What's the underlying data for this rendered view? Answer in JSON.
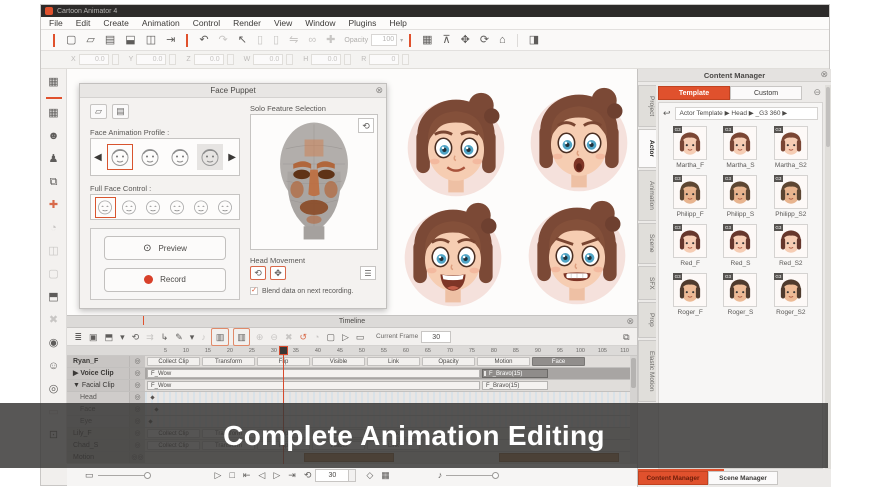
{
  "icons": {
    "close": "⊗",
    "collapse": "⊖",
    "caret": "▾",
    "left": "◀",
    "right": "▶",
    "check": "✓",
    "back": "↩",
    "refresh": "⟲",
    "list": "☰",
    "gear": "◎",
    "eye": "⊙",
    "open": "▱",
    "save": "▤",
    "rotate": "⟲",
    "move": "✥",
    "note": "♪",
    "panel": "⧉"
  },
  "window": {
    "app_title": "Cartoon Animator 4",
    "menu_items": [
      "File",
      "Edit",
      "Create",
      "Animation",
      "Control",
      "Render",
      "View",
      "Window",
      "Plugins",
      "Help"
    ]
  },
  "toolbar": {
    "group1": [
      {
        "glyph": "▢",
        "name": "new-project-icon"
      },
      {
        "glyph": "▱",
        "name": "open-project-icon"
      },
      {
        "glyph": "▤",
        "name": "save-project-icon"
      },
      {
        "glyph": "⬓",
        "name": "content-store-icon"
      },
      {
        "glyph": "◫",
        "name": "export-image-icon"
      },
      {
        "glyph": "⇥",
        "name": "export-icon"
      }
    ],
    "group2": [
      {
        "glyph": "↶",
        "name": "undo-icon"
      },
      {
        "glyph": "↷",
        "name": "redo-icon",
        "cls": "dim"
      },
      {
        "glyph": "↖",
        "name": "select-tool-icon"
      },
      {
        "glyph": "▯",
        "name": "copy-icon",
        "cls": "dim"
      },
      {
        "glyph": "▯",
        "name": "paste-icon",
        "cls": "dim"
      },
      {
        "glyph": "⇋",
        "name": "flip-icon",
        "cls": "dim"
      },
      {
        "glyph": "∞",
        "name": "link-icon",
        "cls": "dim"
      },
      {
        "glyph": "✚",
        "name": "add-icon",
        "cls": "dim"
      }
    ],
    "opacity_label": "Opacity",
    "opacity_value": "100",
    "group3": [
      {
        "glyph": "▦",
        "name": "render-style-icon"
      },
      {
        "glyph": "⊼",
        "name": "pin-icon"
      },
      {
        "glyph": "✥",
        "name": "move-tool-icon"
      },
      {
        "glyph": "⟳",
        "name": "rotate-tool-icon"
      },
      {
        "glyph": "⌂",
        "name": "home-view-icon"
      }
    ],
    "group4": [
      {
        "glyph": "◨",
        "name": "panel-toggle-icon"
      }
    ]
  },
  "transform_bar": {
    "fields": [
      {
        "label": "X",
        "value": "0.0"
      },
      {
        "label": "Y",
        "value": "0.0"
      },
      {
        "label": "Z",
        "value": "0.0"
      },
      {
        "label": "W",
        "value": "0.0"
      },
      {
        "label": "H",
        "value": "0.0"
      },
      {
        "label": "R",
        "value": "0"
      }
    ]
  },
  "sidebar": {
    "icons": [
      {
        "glyph": "▦",
        "name": "stage-media-icon"
      },
      {
        "glyph": "☻",
        "name": "actor-icon"
      },
      {
        "glyph": "♟",
        "name": "motion-icon"
      },
      {
        "glyph": "⧉",
        "name": "layer-manager-icon"
      },
      {
        "glyph": "✚",
        "name": "plugin-icon",
        "cls": "red"
      },
      {
        "glyph": "◔",
        "name": "face-key-icon",
        "cls": "dim"
      },
      {
        "glyph": "◫",
        "name": "sprite-editor-icon",
        "cls": "dim"
      },
      {
        "glyph": "▢",
        "name": "free-form-icon",
        "cls": "dim"
      },
      {
        "glyph": "⬒",
        "name": "prop-icon"
      },
      {
        "glyph": "✖",
        "name": "delete-object-icon",
        "cls": "dim"
      },
      {
        "glyph": "◉",
        "name": "camera-icon"
      },
      {
        "glyph": "☺",
        "name": "face-puppet-icon"
      },
      {
        "glyph": "◎",
        "name": "face-mocap-icon"
      },
      {
        "glyph": "▭",
        "name": "timeline-toggle-icon",
        "cls": "dim"
      },
      {
        "glyph": "⊡",
        "name": "render-icon"
      }
    ]
  },
  "viewport": {
    "faces": [
      {
        "name": "character-head-smile"
      },
      {
        "name": "character-head-surprised"
      },
      {
        "name": "character-head-laugh"
      },
      {
        "name": "character-head-grimace"
      }
    ]
  },
  "face_puppet": {
    "title": "Face Puppet",
    "solo_feature_label": "Solo Feature Selection",
    "profile_label": "Face Animation Profile :",
    "full_face_label": "Full Face Control :",
    "preview_label": "Preview",
    "record_label": "Record",
    "head_movement_label": "Head Movement",
    "blend_checkbox_label": "Blend data on next recording.",
    "profile_faces": [
      {
        "name": "profile-face-girl",
        "cls": "selected"
      },
      {
        "name": "profile-face-boy"
      },
      {
        "name": "profile-face-round"
      },
      {
        "name": "profile-face-plain",
        "cls": "shaded"
      }
    ],
    "full_face_icons": [
      {
        "name": "full-face-1",
        "cls": "selected"
      },
      {
        "name": "full-face-2"
      },
      {
        "name": "full-face-3"
      },
      {
        "name": "full-face-4"
      },
      {
        "name": "full-face-5"
      },
      {
        "name": "full-face-6"
      }
    ]
  },
  "timeline": {
    "title": "Timeline",
    "current_frame_label": "Current Frame",
    "current_frame_value": "30",
    "toolbar_icons": [
      {
        "glyph": "≣",
        "name": "track-list-icon"
      },
      {
        "glyph": "▣",
        "name": "object-track-icon"
      },
      {
        "glyph": "⬒",
        "name": "collect-clip-icon"
      },
      {
        "glyph": "▾",
        "name": "collect-clip-caret-icon"
      },
      {
        "glyph": "⟲",
        "name": "loop-clip-icon"
      },
      {
        "glyph": "⇉",
        "name": "shift-keys-icon",
        "cls": "dim"
      },
      {
        "glyph": "↳",
        "name": "break-clip-icon"
      },
      {
        "glyph": "✎",
        "name": "edit-motion-icon"
      },
      {
        "glyph": "▾",
        "name": "edit-motion-caret-icon"
      },
      {
        "glyph": "♪",
        "name": "audio-track-icon",
        "cls": "dim"
      },
      {
        "glyph": "▥",
        "name": "zoom-region-icon",
        "cls": "framed"
      },
      {
        "glyph": "▥",
        "name": "zoom-fit-icon",
        "cls": "framed"
      },
      {
        "glyph": "⊕",
        "name": "zoom-in-icon",
        "cls": "dim"
      },
      {
        "glyph": "⊖",
        "name": "zoom-out-icon",
        "cls": "dim"
      },
      {
        "glyph": "✖",
        "name": "delete-key-icon",
        "cls": "dim"
      },
      {
        "glyph": "↺",
        "name": "reset-key-icon",
        "cls": "red"
      },
      {
        "glyph": "◔",
        "name": "sample-key-icon",
        "cls": "dim"
      },
      {
        "glyph": "▢",
        "name": "range-select-icon"
      },
      {
        "glyph": "▷",
        "name": "play-range-icon"
      },
      {
        "glyph": "▭",
        "name": "stop-range-icon"
      }
    ],
    "ruler": [
      "5",
      "10",
      "15",
      "20",
      "25",
      "30",
      "35",
      "40",
      "45",
      "50",
      "55",
      "60",
      "65",
      "70",
      "75",
      "80",
      "85",
      "90",
      "95",
      "100",
      "105",
      "110"
    ],
    "tracks": [
      {
        "name": "Ryan_F"
      },
      {
        "name": "Voice Clip",
        "arrow": "▶"
      },
      {
        "name": "Facial Clip",
        "arrow": "▼"
      },
      {
        "name": "Head"
      },
      {
        "name": "Face"
      },
      {
        "name": "Eye"
      },
      {
        "name": "Lily_F"
      },
      {
        "name": "Chad_S"
      },
      {
        "name": "Motion"
      }
    ],
    "track_buttons": [
      {
        "label": "Collect Clip"
      },
      {
        "label": "Transform"
      },
      {
        "label": "Flip"
      },
      {
        "label": "Visible"
      },
      {
        "label": "Link"
      },
      {
        "label": "Opacity"
      },
      {
        "label": "Motion"
      },
      {
        "label": "Face",
        "cls": "active"
      }
    ],
    "track_buttons_small": [
      {
        "label": "Collect Clip"
      },
      {
        "label": "Transform"
      },
      {
        "label": "Flip"
      },
      {
        "label": "Visible"
      },
      {
        "label": "Link"
      }
    ],
    "clips": {
      "voice_main": "F_Wow",
      "voice_selected": "F_Bravo(15)",
      "facial_main": "F_Wow",
      "facial_selected": "F_Bravo(15)"
    }
  },
  "playback": {
    "transport": [
      {
        "glyph": "▷",
        "name": "play-button"
      },
      {
        "glyph": "□",
        "name": "stop-button"
      },
      {
        "glyph": "⇤",
        "name": "first-frame-button"
      },
      {
        "glyph": "◁",
        "name": "previous-frame-button"
      },
      {
        "glyph": "▷",
        "name": "next-frame-button"
      },
      {
        "glyph": "⇥",
        "name": "last-frame-button"
      },
      {
        "glyph": "⟲",
        "name": "loop-playback-button"
      }
    ],
    "frame_value": "30",
    "right_icons": [
      {
        "glyph": "◇",
        "name": "play-settings-icon"
      },
      {
        "glyph": "▦",
        "name": "display-mode-icon"
      }
    ]
  },
  "content_manager": {
    "title": "Content Manager",
    "tabs": [
      {
        "label": "Template",
        "cls": "active"
      },
      {
        "label": "Custom"
      }
    ],
    "breadcrumb": "Actor Template ▶  Head ▶  _G3 360 ▶",
    "badge": "G3",
    "items": [
      {
        "label": "Martha_F",
        "hair": "#7a4634",
        "skin": "#f6cdb4"
      },
      {
        "label": "Martha_S",
        "hair": "#7a4634",
        "skin": "#f6cdb4"
      },
      {
        "label": "Martha_S2",
        "hair": "#7a4634",
        "skin": "#f6cdb4"
      },
      {
        "label": "Philipp_F",
        "hair": "#5d4632",
        "skin": "#e8b48e"
      },
      {
        "label": "Philipp_S",
        "hair": "#5d4632",
        "skin": "#e8b48e"
      },
      {
        "label": "Philipp_S2",
        "hair": "#5d4632",
        "skin": "#e8b48e"
      },
      {
        "label": "Red_F",
        "hair": "#66372c",
        "skin": "#f6cdb4"
      },
      {
        "label": "Red_S",
        "hair": "#66372c",
        "skin": "#f6cdb4"
      },
      {
        "label": "Red_S2",
        "hair": "#66372c",
        "skin": "#f6cdb4"
      },
      {
        "label": "Roger_F",
        "hair": "#4f3b2d",
        "skin": "#edbb96"
      },
      {
        "label": "Roger_S",
        "hair": "#4f3b2d",
        "skin": "#edbb96"
      },
      {
        "label": "Roger_S2",
        "hair": "#4f3b2d",
        "skin": "#edbb96"
      }
    ],
    "side_tabs": [
      {
        "label": "Project"
      },
      {
        "label": "Actor",
        "cls": "active"
      },
      {
        "label": "Animation"
      },
      {
        "label": "Scene"
      },
      {
        "label": "SFX"
      },
      {
        "label": "Prop"
      },
      {
        "label": "Elastic Motion"
      }
    ],
    "bottom_tabs": [
      {
        "label": "Content Manager",
        "cls": "active"
      },
      {
        "label": "Scene Manager"
      }
    ]
  },
  "overlay": {
    "caption": "Complete Animation Editing"
  }
}
